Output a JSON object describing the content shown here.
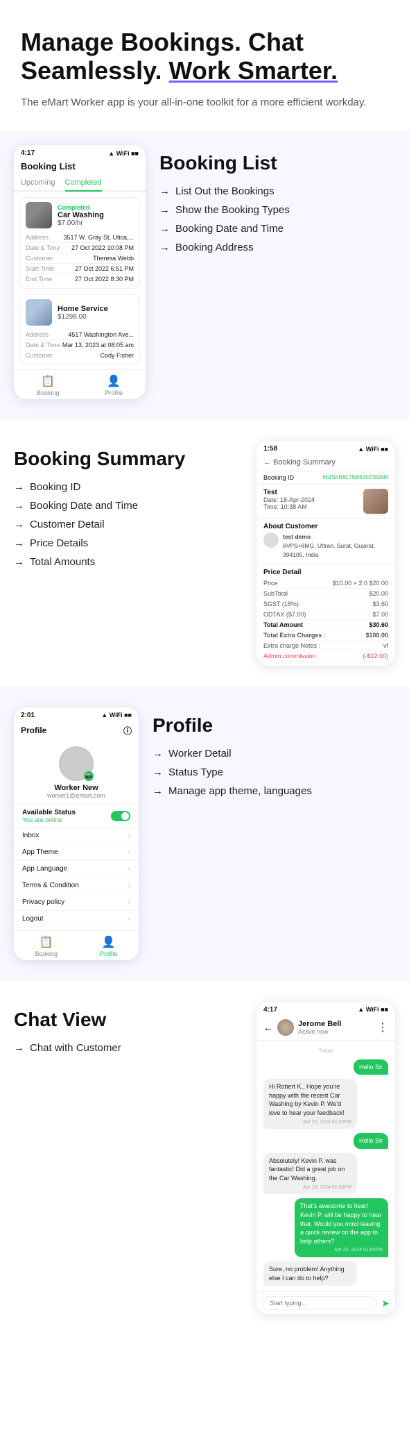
{
  "hero": {
    "title_line1": "Manage Bookings. Chat",
    "title_line2": "Seamlessly. ",
    "title_line2_underline": "Work Smarter.",
    "subtitle": "The eMart Worker app is your all-in-one toolkit for a more efficient workday."
  },
  "booking_list_section": {
    "section_title": "Booking List",
    "phone": {
      "status_time": "4:17",
      "header": "Booking List",
      "tab_upcoming": "Upcoming",
      "tab_completed": "Completed",
      "card1": {
        "badge": "Completed",
        "title": "Car Washing",
        "price": "$7.00/hr",
        "rows": [
          {
            "label": "Address",
            "value": "3517 W. Gray St, Utica,..."
          },
          {
            "label": "Date & Time",
            "value": "27 Oct 2022 10:08 PM"
          },
          {
            "label": "Customer",
            "value": "Theresa Webb"
          },
          {
            "label": "Start Time",
            "value": "27 Oct 2022 6:51 PM"
          },
          {
            "label": "End Time",
            "value": "27 Oct 2022 8:30 PM"
          }
        ]
      },
      "card2": {
        "title": "Home Service",
        "price": "$1298.00",
        "rows": [
          {
            "label": "Address",
            "value": "4517 Washington Ave..."
          },
          {
            "label": "Date & Time",
            "value": "Mar 13, 2023 at 08:05 am"
          },
          {
            "label": "Customer",
            "value": "Cody Fisher"
          }
        ]
      },
      "nav_booking": "Booking",
      "nav_profile": "Profile"
    },
    "features": [
      "List Out the Bookings",
      "Show the Booking Types",
      "Booking Date and Time",
      "Booking Address"
    ]
  },
  "booking_summary_section": {
    "section_title": "Booking Summary",
    "features": [
      "Booking ID",
      "Booking Date and Time",
      "Customer Detail",
      "Price Details",
      "Total Amounts"
    ],
    "phone": {
      "status_time": "1:58",
      "back_label": "← Booking Summary",
      "booking_id_label": "Booking ID",
      "booking_id_value": "#b1ShR6L75j66J4OSGM8",
      "test_label": "Test",
      "test_date": "Date: 18-Apr-2024",
      "test_time": "Time: 10:38 AM",
      "about_customer_title": "About Customer",
      "customer_name": "test demo",
      "customer_address": "6VPS+6MG, Uttran, Surat, Gujarat, 394105, India",
      "price_detail_title": "Price Detail",
      "price_rows": [
        {
          "label": "Price",
          "value": "$10.00 × 2.0  $20.00"
        },
        {
          "label": "SubTotal",
          "value": "$20.00"
        },
        {
          "label": "SGST (18%)",
          "value": "$3.60"
        },
        {
          "label": "ODTAX ($7.00)",
          "value": "$7.00"
        },
        {
          "label": "Total Amount",
          "value": "$30.60"
        },
        {
          "label": "Total Extra Charges :",
          "value": "$100.00"
        },
        {
          "label": "Extra charge Notes :",
          "value": "vf"
        },
        {
          "label": "Admin commission",
          "value": "(-$12.00)"
        }
      ]
    }
  },
  "profile_section": {
    "section_title": "Profile",
    "features": [
      "Worker Detail",
      "Status Type",
      "Manage app theme, languages"
    ],
    "phone": {
      "status_time": "2:01",
      "header": "Profile",
      "worker_name": "Worker New",
      "worker_email": "worker1@emart.com",
      "status_label": "Available Status",
      "status_online": "You are online",
      "menu_items": [
        "Inbox",
        "App Theme",
        "App Language",
        "Terms & Condition",
        "Privacy policy",
        "Logout"
      ],
      "nav_booking": "Booking",
      "nav_profile": "Profile"
    }
  },
  "chat_section": {
    "section_title": "Chat View",
    "features": [
      "Chat with Customer"
    ],
    "phone": {
      "status_time": "4:17",
      "user_name": "Jerome Bell",
      "user_status": "Active now",
      "date_divider": "Today",
      "messages": [
        {
          "type": "sent",
          "text": "Hello Sir",
          "time": ""
        },
        {
          "type": "received",
          "text": "Hi Robert K., Hope you're happy with the recent Car Washing by Kevin P. We'd love to hear your feedback!",
          "time": "Apr 20, 2024 01:00PM"
        },
        {
          "type": "sent",
          "text": "Hello Sir",
          "time": ""
        },
        {
          "type": "received",
          "text": "Absolutely! Kevin P. was fantastic! Did a great job on the Car Washing.",
          "time": "Apr 20, 2024 01:00PM"
        },
        {
          "type": "sent",
          "text": "That's awesome to hear! Kevin P. will be happy to hear that. Would you mind leaving a quick review on the app to help others?",
          "time": "Apr 20, 2024 01:00PM"
        },
        {
          "type": "received",
          "text": "Sure, no problem! Anything else I can do to help?",
          "time": ""
        }
      ],
      "input_placeholder": "Start typing..."
    }
  }
}
